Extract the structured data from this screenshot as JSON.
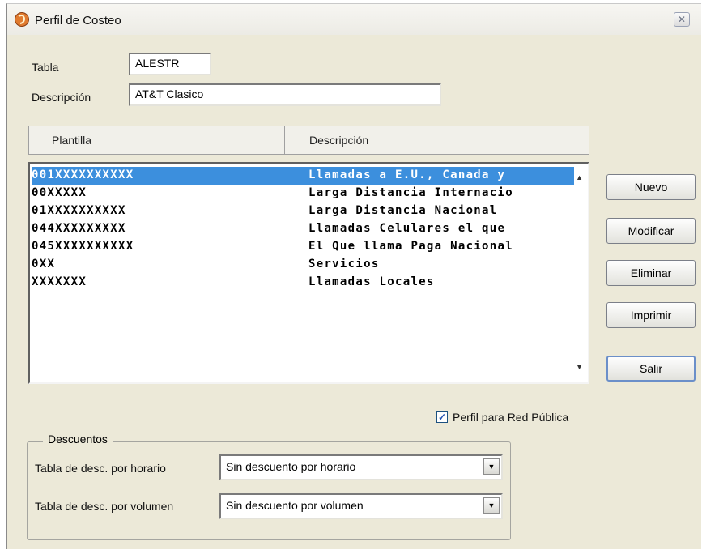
{
  "window": {
    "title": "Perfil de Costeo",
    "close_label": "✕"
  },
  "form": {
    "tabla_label": "Tabla",
    "tabla_value": "ALESTR",
    "descripcion_label": "Descripción",
    "descripcion_value": "AT&T Clasico"
  },
  "grid": {
    "columns": [
      "Plantilla",
      "Descripción"
    ],
    "rows": [
      {
        "plantilla": "001XXXXXXXXXX",
        "descripcion": "Llamadas a E.U., Canada y",
        "selected": true
      },
      {
        "plantilla": "00XXXXX",
        "descripcion": "Larga Distancia Internacio",
        "selected": false
      },
      {
        "plantilla": "01XXXXXXXXXX",
        "descripcion": "Larga Distancia Nacional",
        "selected": false
      },
      {
        "plantilla": "044XXXXXXXXX",
        "descripcion": "Llamadas Celulares el que",
        "selected": false
      },
      {
        "plantilla": "045XXXXXXXXXX",
        "descripcion": "El Que llama Paga Nacional",
        "selected": false
      },
      {
        "plantilla": "0XX",
        "descripcion": "Servicios",
        "selected": false
      },
      {
        "plantilla": "XXXXXXX",
        "descripcion": "Llamadas Locales",
        "selected": false
      }
    ]
  },
  "buttons": {
    "nuevo": "Nuevo",
    "modificar": "Modificar",
    "eliminar": "Eliminar",
    "imprimir": "Imprimir",
    "salir": "Salir"
  },
  "checkbox": {
    "label": "Perfil para Red Pública",
    "checked": true
  },
  "descuentos": {
    "legend": "Descuentos",
    "horario_label": "Tabla de desc. por horario",
    "horario_value": "Sin descuento por horario",
    "volumen_label": "Tabla de desc. por volumen",
    "volumen_value": "Sin descuento por volumen"
  },
  "colors": {
    "selection": "#3c8fdd",
    "window_bg": "#ece9d8"
  }
}
